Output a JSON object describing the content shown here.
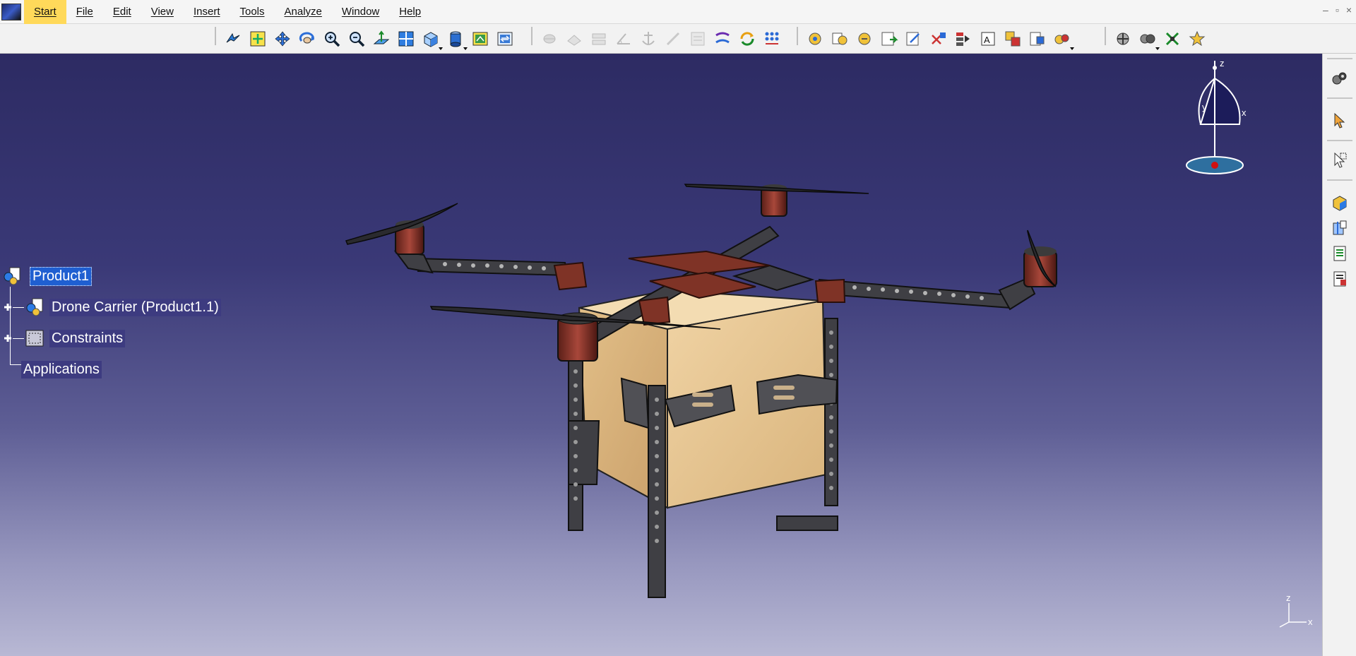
{
  "menubar": {
    "items": [
      "Start",
      "File",
      "Edit",
      "View",
      "Insert",
      "Tools",
      "Analyze",
      "Window",
      "Help"
    ],
    "active": "Start"
  },
  "window_controls": [
    "–",
    "▫",
    "×"
  ],
  "spec_tree": {
    "root": "Product1",
    "children": [
      {
        "label": "Drone Carrier (Product1.1)"
      },
      {
        "label": "Constraints"
      },
      {
        "label": "Applications"
      }
    ]
  },
  "compass": {
    "x": "x",
    "y": "y",
    "z": "z"
  },
  "mini_axis": {
    "x": "x",
    "z": "z"
  },
  "colors": {
    "menu_highlight": "#ffd95a",
    "viewport_top": "#2d2b63",
    "viewport_bottom": "#b8b8d4",
    "selection": "#1f5fd1",
    "box": "#e9c795",
    "frame": "#4a4a4a",
    "plate_red": "#7f3326"
  }
}
